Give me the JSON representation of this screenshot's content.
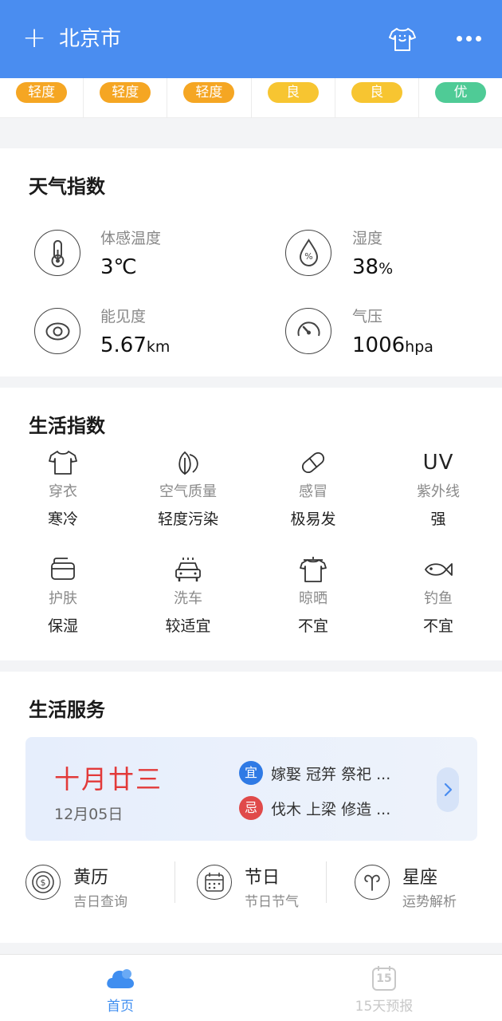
{
  "header": {
    "plus": "+",
    "city": "北京市",
    "shirt_icon": "tshirt-icon",
    "more_icon": "more-dots-icon"
  },
  "aqi": [
    {
      "label": "轻度",
      "color": "#f5a623"
    },
    {
      "label": "轻度",
      "color": "#f5a623"
    },
    {
      "label": "轻度",
      "color": "#f5a623"
    },
    {
      "label": "良",
      "color": "#f7c531"
    },
    {
      "label": "良",
      "color": "#f7c531"
    },
    {
      "label": "优",
      "color": "#4fcb96"
    }
  ],
  "weather_index": {
    "title": "天气指数",
    "items": [
      {
        "label": "体感温度",
        "value": "3℃",
        "unit": "",
        "icon": "thermometer-icon"
      },
      {
        "label": "湿度",
        "value": "38",
        "unit": "%",
        "icon": "humidity-drop-icon"
      },
      {
        "label": "能见度",
        "value": "5.67",
        "unit": "km",
        "icon": "eye-icon"
      },
      {
        "label": "气压",
        "value": "1006",
        "unit": "hpa",
        "icon": "pressure-gauge-icon"
      }
    ]
  },
  "life_index": {
    "title": "生活指数",
    "items": [
      {
        "label": "穿衣",
        "value": "寒冷",
        "icon": "tshirt-icon"
      },
      {
        "label": "空气质量",
        "value": "轻度污染",
        "icon": "leaf-icon"
      },
      {
        "label": "感冒",
        "value": "极易发",
        "icon": "pill-icon"
      },
      {
        "label": "紫外线",
        "value": "强",
        "icon": "uv-icon",
        "icon_text": "UV"
      },
      {
        "label": "护肤",
        "value": "保湿",
        "icon": "wallet-icon"
      },
      {
        "label": "洗车",
        "value": "较适宜",
        "icon": "car-icon"
      },
      {
        "label": "晾晒",
        "value": "不宜",
        "icon": "hanger-shirt-icon"
      },
      {
        "label": "钓鱼",
        "value": "不宜",
        "icon": "fish-icon"
      }
    ]
  },
  "services": {
    "title": "生活服务",
    "almanac": {
      "lunar_date": "十月廿三",
      "date": "12月05日",
      "yi_badge": "宜",
      "yi_text": "嫁娶 冠笄 祭祀 ...",
      "ji_badge": "忌",
      "ji_text": "伐木 上梁 修造 ..."
    },
    "items": [
      {
        "title": "黄历",
        "subtitle": "吉日查询",
        "icon": "coin-icon"
      },
      {
        "title": "节日",
        "subtitle": "节日节气",
        "icon": "calendar-icon"
      },
      {
        "title": "星座",
        "subtitle": "运势解析",
        "icon": "aries-icon"
      }
    ]
  },
  "bottom_nav": [
    {
      "label": "首页",
      "icon": "cloud-icon",
      "active": true
    },
    {
      "label": "15天预报",
      "icon": "calendar-15-icon",
      "icon_text": "15",
      "active": false
    }
  ],
  "colors": {
    "brand": "#4a8df0",
    "lunar_red": "#e23a3a",
    "yi_blue": "#2f7ae5",
    "ji_red": "#e04a4a",
    "inactive": "#c8c8c8"
  }
}
